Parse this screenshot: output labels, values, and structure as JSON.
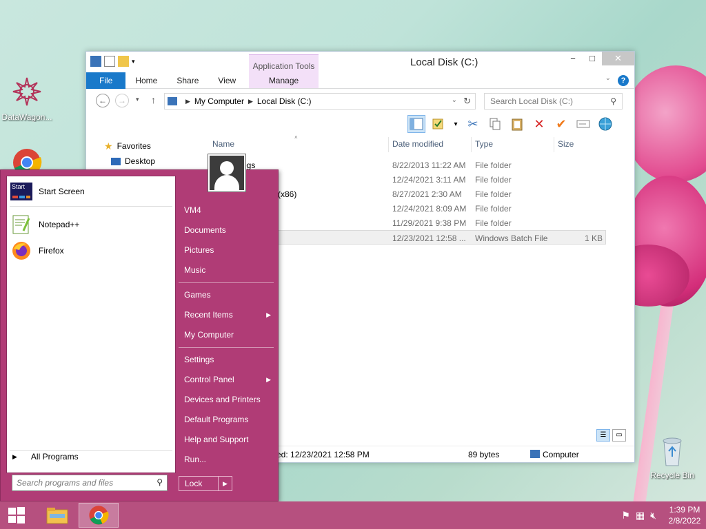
{
  "desktop": {
    "icons": [
      {
        "label": "DataWagon...",
        "icon": "datawagon-icon"
      },
      {
        "label": "Recycle Bin",
        "icon": "recycle-bin-icon"
      }
    ]
  },
  "explorer": {
    "title": "Local Disk (C:)",
    "context_tab_title": "Application Tools",
    "tabs": {
      "file": "File",
      "home": "Home",
      "share": "Share",
      "view": "View",
      "manage": "Manage"
    },
    "address": {
      "root": "My Computer",
      "current": "Local Disk (C:)"
    },
    "search_placeholder": "Search Local Disk (C:)",
    "nav_pane": {
      "favorites": "Favorites",
      "desktop": "Desktop"
    },
    "columns": {
      "name": "Name",
      "date": "Date modified",
      "type": "Type",
      "size": "Size"
    },
    "files": [
      {
        "name": "ogs",
        "date": "8/22/2013 11:22 AM",
        "type": "File folder",
        "size": ""
      },
      {
        "name": "",
        "date": "12/24/2021 3:11 AM",
        "type": "File folder",
        "size": ""
      },
      {
        "name": "(x86)",
        "date": "8/27/2021 2:30 AM",
        "type": "File folder",
        "size": ""
      },
      {
        "name": "",
        "date": "12/24/2021 8:09 AM",
        "type": "File folder",
        "size": ""
      },
      {
        "name": "",
        "date": "11/29/2021 9:38 PM",
        "type": "File folder",
        "size": ""
      },
      {
        "name": "",
        "date": "12/23/2021 12:58 ...",
        "type": "Windows Batch File",
        "size": "1 KB"
      }
    ],
    "status": {
      "modified": "fied: 12/23/2021 12:58 PM",
      "size": "89 bytes",
      "location": "Computer"
    }
  },
  "start_menu": {
    "programs": [
      {
        "label": "Start Screen",
        "icon": "start-screen-icon"
      },
      {
        "label": "Notepad++",
        "icon": "notepad-plus-plus-icon"
      },
      {
        "label": "Firefox",
        "icon": "firefox-icon"
      }
    ],
    "start_icon_text": "Start",
    "all_programs": "All Programs",
    "search_placeholder": "Search programs and files",
    "right_groups": [
      [
        {
          "label": "VM4"
        },
        {
          "label": "Documents"
        },
        {
          "label": "Pictures"
        },
        {
          "label": "Music"
        }
      ],
      [
        {
          "label": "Games"
        },
        {
          "label": "Recent Items",
          "arrow": true
        },
        {
          "label": "My Computer"
        }
      ],
      [
        {
          "label": "Settings"
        },
        {
          "label": "Control Panel",
          "arrow": true
        },
        {
          "label": "Devices and Printers"
        },
        {
          "label": "Default Programs"
        },
        {
          "label": "Help and Support"
        },
        {
          "label": "Run..."
        }
      ]
    ],
    "lock": "Lock"
  },
  "taskbar": {
    "time": "1:39 PM",
    "date": "2/8/2022",
    "tray_icons": [
      "action-center-flag-icon",
      "network-icon",
      "volume-muted-icon"
    ]
  }
}
